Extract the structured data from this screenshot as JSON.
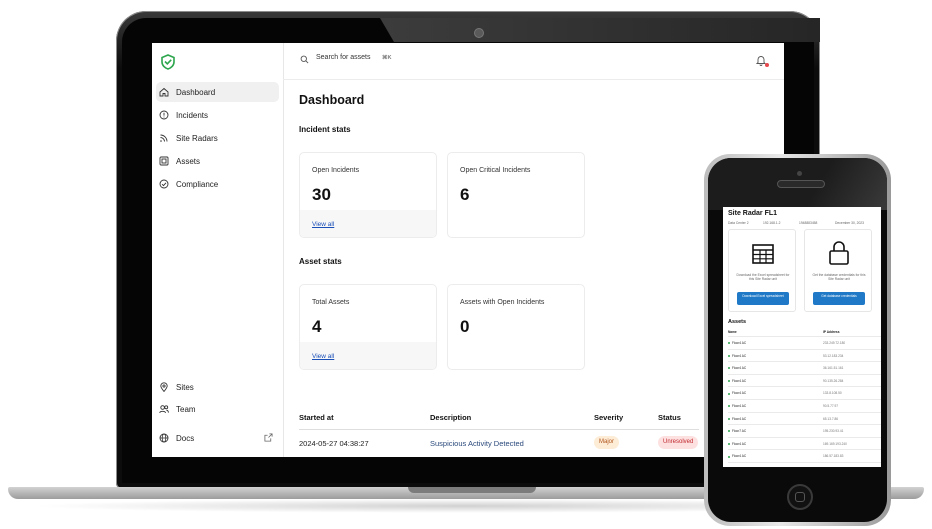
{
  "laptop": {
    "sidebar": {
      "items": [
        {
          "label": "Dashboard",
          "icon": "home-icon"
        },
        {
          "label": "Incidents",
          "icon": "alert-circle-icon"
        },
        {
          "label": "Site Radars",
          "icon": "radar-icon"
        },
        {
          "label": "Assets",
          "icon": "asset-box-icon"
        },
        {
          "label": "Compliance",
          "icon": "check-circle-icon"
        }
      ],
      "bottom_items": [
        {
          "label": "Sites",
          "icon": "location-pin-icon"
        },
        {
          "label": "Team",
          "icon": "users-icon"
        },
        {
          "label": "Docs",
          "icon": "globe-icon"
        }
      ],
      "active": "Dashboard"
    },
    "topbar": {
      "search_placeholder": "Search for assets",
      "shortcut": "⌘K"
    },
    "main": {
      "title": "Dashboard",
      "incident_section": "Incident stats",
      "incident_cards": [
        {
          "label": "Open Incidents",
          "value": "30",
          "link": "View all"
        },
        {
          "label": "Open Critical Incidents",
          "value": "6"
        }
      ],
      "asset_section": "Asset stats",
      "asset_cards": [
        {
          "label": "Total Assets",
          "value": "4",
          "link": "View all"
        },
        {
          "label": "Assets with Open Incidents",
          "value": "0"
        }
      ],
      "table": {
        "columns": [
          "Started at",
          "Description",
          "Severity",
          "Status"
        ],
        "rows": [
          {
            "started": "2024-05-27 04:38:27",
            "description": "Suspicious Activity Detected",
            "severity": "Major",
            "status": "Unresolved"
          }
        ]
      }
    }
  },
  "phone": {
    "title": "Site Radar FL1",
    "meta": [
      "Data Center 2",
      "192.168.1.2",
      "1948883458",
      "December 30, 2023"
    ],
    "cards": [
      {
        "text": "Download the Excel spreadsheet for this Site Radar unit",
        "button": "Download Excel spreadsheet",
        "icon": "table-icon"
      },
      {
        "text": "Get the database credentials for this Site Radar unit",
        "button": "Get database credentials",
        "icon": "lock-icon"
      }
    ],
    "assets_heading": "Assets",
    "columns": [
      "Name",
      "IP Address"
    ],
    "assets": [
      {
        "name": "Floor4 AC",
        "ip": "233.249.72.180"
      },
      {
        "name": "Floor4 AC",
        "ip": "53.12.183.234"
      },
      {
        "name": "Floor4 AC",
        "ip": "36.161.51.161"
      },
      {
        "name": "Floor4 AC",
        "ip": "90.135.26.284"
      },
      {
        "name": "Floor4 AC",
        "ip": "133.8.108.50"
      },
      {
        "name": "Floor4 AC",
        "ip": "90.5.77.97"
      },
      {
        "name": "Floor4 AC",
        "ip": "65.13.7.86"
      },
      {
        "name": "Floor7 AC",
        "ip": "195.230.93.41"
      },
      {
        "name": "Floor4 AC",
        "ip": "169.169.193.240"
      },
      {
        "name": "Floor4 AC",
        "ip": "186.57.183.83"
      }
    ]
  },
  "colors": {
    "brand_green": "#2ca54d",
    "link_blue": "#1a4fb8",
    "button_blue": "#1f79c7",
    "major_bg": "#fdecd6",
    "unresolved_bg": "#fde1e1"
  }
}
